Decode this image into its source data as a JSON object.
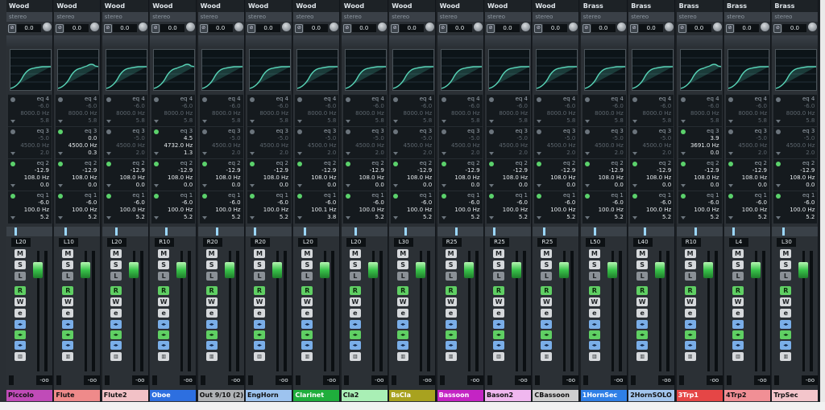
{
  "channels": [
    {
      "group": "Wood",
      "type": "stereo",
      "input": "0.0",
      "name": "Piccolo",
      "name_bg": "#c04bb8",
      "name_fg": "#101010",
      "pan": "L20",
      "vol": "-oo",
      "eq4": [
        "",
        "",
        "",
        "eq 4",
        "-6.0",
        "8000.0 Hz",
        "5.8"
      ],
      "eq3": [
        "eq 3",
        "-5.0",
        "4500.0 Hz",
        "2.0"
      ],
      "eq2": [
        "eq 2",
        "-12.9",
        "108.0 Hz",
        "0.0"
      ],
      "eq1": [
        "eq 1",
        "-6.0",
        "100.0 Hz",
        "5.2"
      ],
      "eq3_on": false
    },
    {
      "group": "Wood",
      "type": "stereo",
      "input": "0.0",
      "name": "Flute",
      "name_bg": "#ef8a8a",
      "name_fg": "#101010",
      "pan": "L10",
      "vol": "-oo",
      "eq4": [
        "eq 4",
        "-6.0",
        "8000.0 Hz",
        "5.8"
      ],
      "eq3": [
        "eq 3",
        "0.0",
        "4500.0 Hz",
        "0.3"
      ],
      "eq2": [
        "eq 2",
        "-12.9",
        "108.0 Hz",
        "0.0"
      ],
      "eq1": [
        "eq 1",
        "-6.0",
        "100.0 Hz",
        "5.2"
      ],
      "eq3_on": true
    },
    {
      "group": "Wood",
      "type": "stereo",
      "input": "0.0",
      "name": "Flute2",
      "name_bg": "#f2c1c6",
      "name_fg": "#101010",
      "pan": "L20",
      "vol": "-oo",
      "eq4": [
        "eq 4",
        "-6.0",
        "8000.0 Hz",
        "5.8"
      ],
      "eq3": [
        "eq 3",
        "-5.0",
        "4500.0 Hz",
        "2.0"
      ],
      "eq2": [
        "eq 2",
        "-12.9",
        "108.0 Hz",
        "0.0"
      ],
      "eq1": [
        "eq 1",
        "-6.0",
        "100.0 Hz",
        "5.2"
      ],
      "eq3_on": false
    },
    {
      "group": "Wood",
      "type": "stereo",
      "input": "0.0",
      "name": "Oboe",
      "name_bg": "#2d6fe0",
      "name_fg": "#ffffff",
      "pan": "R10",
      "vol": "-oo",
      "eq4": [
        "eq 4",
        "-6.0",
        "8000.0 Hz",
        "5.8"
      ],
      "eq3": [
        "eq 3",
        "4.5",
        "4732.0 Hz",
        "1.3"
      ],
      "eq2": [
        "eq 2",
        "-12.9",
        "108.0 Hz",
        "0.0"
      ],
      "eq1": [
        "eq 1",
        "-6.0",
        "100.0 Hz",
        "5.2"
      ],
      "eq3_on": true
    },
    {
      "group": "Wood",
      "type": "stereo",
      "input": "0.0",
      "name": "Out 9/10 (2)",
      "name_bg": "#b0b3b6",
      "name_fg": "#101010",
      "pan": "R20",
      "vol": "-oo",
      "eq4": [
        "eq 4",
        "-6.0",
        "8000.0 Hz",
        "5.8"
      ],
      "eq3": [
        "eq 3",
        "-5.0",
        "4500.0 Hz",
        "2.0"
      ],
      "eq2": [
        "eq 2",
        "-12.9",
        "108.0 Hz",
        "0.0"
      ],
      "eq1": [
        "eq 1",
        "-6.0",
        "100.0 Hz",
        "5.2"
      ],
      "eq3_on": false
    },
    {
      "group": "Wood",
      "type": "stereo",
      "input": "0.0",
      "name": "EngHorn",
      "name_bg": "#9dc3ef",
      "name_fg": "#101010",
      "pan": "R20",
      "vol": "-oo",
      "eq4": [
        "eq 4",
        "-6.0",
        "8000.0 Hz",
        "5.8"
      ],
      "eq3": [
        "eq 3",
        "-5.0",
        "4500.0 Hz",
        "2.0"
      ],
      "eq2": [
        "eq 2",
        "-12.9",
        "108.0 Hz",
        "0.0"
      ],
      "eq1": [
        "eq 1",
        "-6.0",
        "100.0 Hz",
        "5.2"
      ],
      "eq3_on": false
    },
    {
      "group": "Wood",
      "type": "stereo",
      "input": "0.0",
      "name": "Clarinet",
      "name_bg": "#1fae3c",
      "name_fg": "#ffffff",
      "pan": "L20",
      "vol": "-oo",
      "eq4": [
        "eq 4",
        "-6.0",
        "8000.0 Hz",
        "5.8"
      ],
      "eq3": [
        "eq 3",
        "-5.0",
        "4500.0 Hz",
        "2.0"
      ],
      "eq2": [
        "eq 2",
        "-12.9",
        "108.0 Hz",
        "0.0"
      ],
      "eq1": [
        "eq 1",
        "-6.0",
        "100.1 Hz",
        "3.8"
      ],
      "eq3_on": false
    },
    {
      "group": "Wood",
      "type": "stereo",
      "input": "0.0",
      "name": "Cla2",
      "name_bg": "#a9efb5",
      "name_fg": "#101010",
      "pan": "L20",
      "vol": "-oo",
      "eq4": [
        "eq 4",
        "-6.0",
        "8000.0 Hz",
        "5.8"
      ],
      "eq3": [
        "eq 3",
        "-5.0",
        "4500.0 Hz",
        "2.0"
      ],
      "eq2": [
        "eq 2",
        "-12.9",
        "108.0 Hz",
        "0.0"
      ],
      "eq1": [
        "eq 1",
        "-6.0",
        "100.0 Hz",
        "5.2"
      ],
      "eq3_on": false
    },
    {
      "group": "Wood",
      "type": "stereo",
      "input": "0.0",
      "name": "BsCla",
      "name_bg": "#a8a21f",
      "name_fg": "#ffffff",
      "pan": "L30",
      "vol": "-oo",
      "eq4": [
        "eq 4",
        "-6.0",
        "8000.0 Hz",
        "5.8"
      ],
      "eq3": [
        "eq 3",
        "-5.0",
        "4500.0 Hz",
        "2.0"
      ],
      "eq2": [
        "eq 2",
        "-12.9",
        "108.0 Hz",
        "0.0"
      ],
      "eq1": [
        "eq 1",
        "-6.0",
        "100.0 Hz",
        "5.2"
      ],
      "eq3_on": false
    },
    {
      "group": "Wood",
      "type": "stereo",
      "input": "0.0",
      "name": "Bassoon",
      "name_bg": "#c424c4",
      "name_fg": "#ffffff",
      "pan": "R25",
      "vol": "-oo",
      "eq4": [
        "eq 4",
        "-6.0",
        "8000.0 Hz",
        "5.8"
      ],
      "eq3": [
        "eq 3",
        "-5.0",
        "4500.0 Hz",
        "2.0"
      ],
      "eq2": [
        "eq 2",
        "-12.9",
        "108.0 Hz",
        "0.0"
      ],
      "eq1": [
        "eq 1",
        "-6.0",
        "100.0 Hz",
        "5.2"
      ],
      "eq3_on": false
    },
    {
      "group": "Wood",
      "type": "stereo",
      "input": "0.0",
      "name": "Bason2",
      "name_bg": "#f0b7ef",
      "name_fg": "#101010",
      "pan": "R25",
      "vol": "-oo",
      "eq4": [
        "eq 4",
        "-6.0",
        "8000.0 Hz",
        "5.8"
      ],
      "eq3": [
        "eq 3",
        "-5.0",
        "4500.0 Hz",
        "2.0"
      ],
      "eq2": [
        "eq 2",
        "-12.9",
        "108.0 Hz",
        "0.0"
      ],
      "eq1": [
        "eq 1",
        "-6.0",
        "100.0 Hz",
        "5.2"
      ],
      "eq3_on": false
    },
    {
      "group": "Wood",
      "type": "stereo",
      "input": "0.0",
      "name": "CBassoon",
      "name_bg": "#cfcfcf",
      "name_fg": "#101010",
      "pan": "R25",
      "vol": "-oo",
      "eq4": [
        "eq 4",
        "-6.0",
        "8000.0 Hz",
        "5.8"
      ],
      "eq3": [
        "eq 3",
        "-5.0",
        "4500.0 Hz",
        "2.0"
      ],
      "eq2": [
        "eq 2",
        "-12.9",
        "108.0 Hz",
        "0.0"
      ],
      "eq1": [
        "eq 1",
        "-6.0",
        "100.0 Hz",
        "5.2"
      ],
      "eq3_on": false
    },
    {
      "group": "Brass",
      "type": "stereo",
      "input": "0.0",
      "name": "1HornSec",
      "name_bg": "#2e7fe6",
      "name_fg": "#ffffff",
      "pan": "L50",
      "vol": "-oo",
      "eq4": [
        "eq 4",
        "-6.0",
        "8000.0 Hz",
        "5.8"
      ],
      "eq3": [
        "eq 3",
        "-5.0",
        "4500.0 Hz",
        "2.0"
      ],
      "eq2": [
        "eq 2",
        "-12.9",
        "108.0 Hz",
        "0.0"
      ],
      "eq1": [
        "eq 1",
        "-6.0",
        "100.0 Hz",
        "5.2"
      ],
      "eq3_on": false
    },
    {
      "group": "Brass",
      "type": "stereo",
      "input": "0.0",
      "name": "2HornSOLO",
      "name_bg": "#a3c5ee",
      "name_fg": "#101010",
      "pan": "L40",
      "vol": "-oo",
      "eq4": [
        "eq 4",
        "-6.0",
        "8000.0 Hz",
        "5.8"
      ],
      "eq3": [
        "eq 3",
        "-5.0",
        "4500.0 Hz",
        "2.0"
      ],
      "eq2": [
        "eq 2",
        "-12.9",
        "108.0 Hz",
        "0.0"
      ],
      "eq1": [
        "eq 1",
        "-6.0",
        "100.0 Hz",
        "5.2"
      ],
      "eq3_on": false
    },
    {
      "group": "Brass",
      "type": "stereo",
      "input": "0.0",
      "name": "3Trp1",
      "name_bg": "#e54646",
      "name_fg": "#ffffff",
      "pan": "R10",
      "vol": "-oo",
      "eq4": [
        "eq 4",
        "-6.0",
        "8000.0 Hz",
        "5.8"
      ],
      "eq3": [
        "eq 3",
        "3.9",
        "3691.0 Hz",
        "0.0"
      ],
      "eq2": [
        "eq 2",
        "-12.9",
        "108.0 Hz",
        "0.0"
      ],
      "eq1": [
        "eq 1",
        "-6.0",
        "100.0 Hz",
        "5.2"
      ],
      "eq3_on": true
    },
    {
      "group": "Brass",
      "type": "stereo",
      "input": "0.0",
      "name": "4Trp2",
      "name_bg": "#f18f95",
      "name_fg": "#101010",
      "pan": "L4",
      "vol": "-oo",
      "eq4": [
        "eq 4",
        "-6.0",
        "8000.0 Hz",
        "5.8"
      ],
      "eq3": [
        "eq 3",
        "-5.0",
        "4500.0 Hz",
        "2.0"
      ],
      "eq2": [
        "eq 2",
        "-12.9",
        "108.0 Hz",
        "0.0"
      ],
      "eq1": [
        "eq 1",
        "-6.0",
        "100.0 Hz",
        "5.2"
      ],
      "eq3_on": false
    },
    {
      "group": "Brass",
      "type": "stereo",
      "input": "0.0",
      "name": "TrpSec",
      "name_bg": "#f3c5cb",
      "name_fg": "#101010",
      "pan": "L30",
      "vol": "-oo",
      "eq4": [
        "eq 4",
        "-6.0",
        "8000.0 Hz",
        "5.8"
      ],
      "eq3": [
        "eq 3",
        "-5.0",
        "4500.0 Hz",
        "2.0"
      ],
      "eq2": [
        "eq 2",
        "-12.9",
        "108.0 Hz",
        "0.0"
      ],
      "eq1": [
        "eq 1",
        "-6.0",
        "100.0 Hz",
        "5.2"
      ],
      "eq3_on": false
    }
  ],
  "buttons": {
    "mute": "M",
    "solo": "S",
    "listen": "L",
    "read": "R",
    "write": "W",
    "edit": "e"
  }
}
